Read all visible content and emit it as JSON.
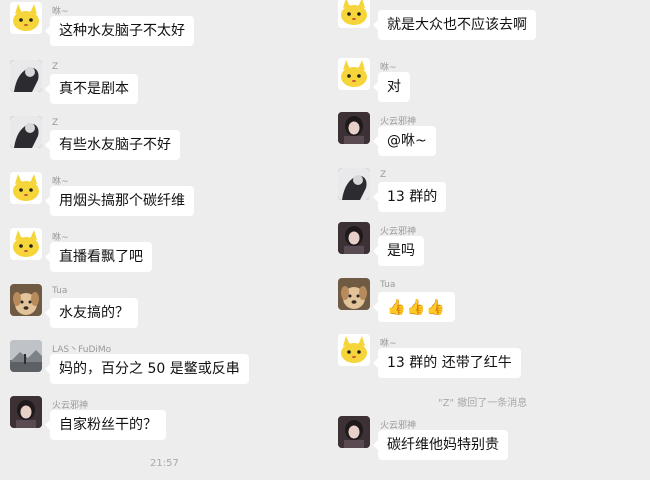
{
  "left_messages": [
    {
      "sender": "咻~",
      "text": "这种水友脑子不太好",
      "avatar": "chick-avatar"
    },
    {
      "sender": "Z",
      "text": "真不是剧本",
      "avatar": "dark-avatar"
    },
    {
      "sender": "Z",
      "text": "有些水友脑子不好",
      "avatar": "dark-avatar"
    },
    {
      "sender": "咻~",
      "text": "用烟头搞那个碳纤维",
      "avatar": "chick-avatar"
    },
    {
      "sender": "咻~",
      "text": "直播看飘了吧",
      "avatar": "chick-avatar"
    },
    {
      "sender": "Tua",
      "text": "水友搞的？",
      "avatar": "dog-avatar"
    },
    {
      "sender": "LAS丶FuDiMo",
      "text": "妈的，百分之 50 是鳖或反串",
      "avatar": "landscape-avatar"
    },
    {
      "sender": "火云邪神",
      "text": "自家粉丝干的？",
      "avatar": "girl-avatar"
    }
  ],
  "left_timestamp": "21:57",
  "right_messages": [
    {
      "sender": "",
      "text": "就是大众也不应该去啊",
      "avatar": "chick-avatar"
    },
    {
      "sender": "咻~",
      "text": "对",
      "avatar": "chick-avatar"
    },
    {
      "sender": "火云邪神",
      "text": "@咻~",
      "avatar": "girl-avatar"
    },
    {
      "sender": "Z",
      "text": "13 群的",
      "avatar": "dark-avatar"
    },
    {
      "sender": "火云邪神",
      "text": "是吗",
      "avatar": "girl-avatar"
    },
    {
      "sender": "Tua",
      "text": "👍👍👍",
      "avatar": "dog-avatar"
    },
    {
      "sender": "咻~",
      "text": "13 群的 还带了红牛",
      "avatar": "chick-avatar"
    },
    {
      "sender": "火云邪神",
      "text": "碳纤维他妈特别贵",
      "avatar": "girl-avatar"
    }
  ],
  "right_system_notice": "\"Z\" 撤回了一条消息",
  "colors": {
    "background": "#ededed",
    "bubble": "#ffffff",
    "sender_name": "#9a9a9a",
    "system_text": "#a8a8a8",
    "chick_yellow": "#f6d53a"
  }
}
